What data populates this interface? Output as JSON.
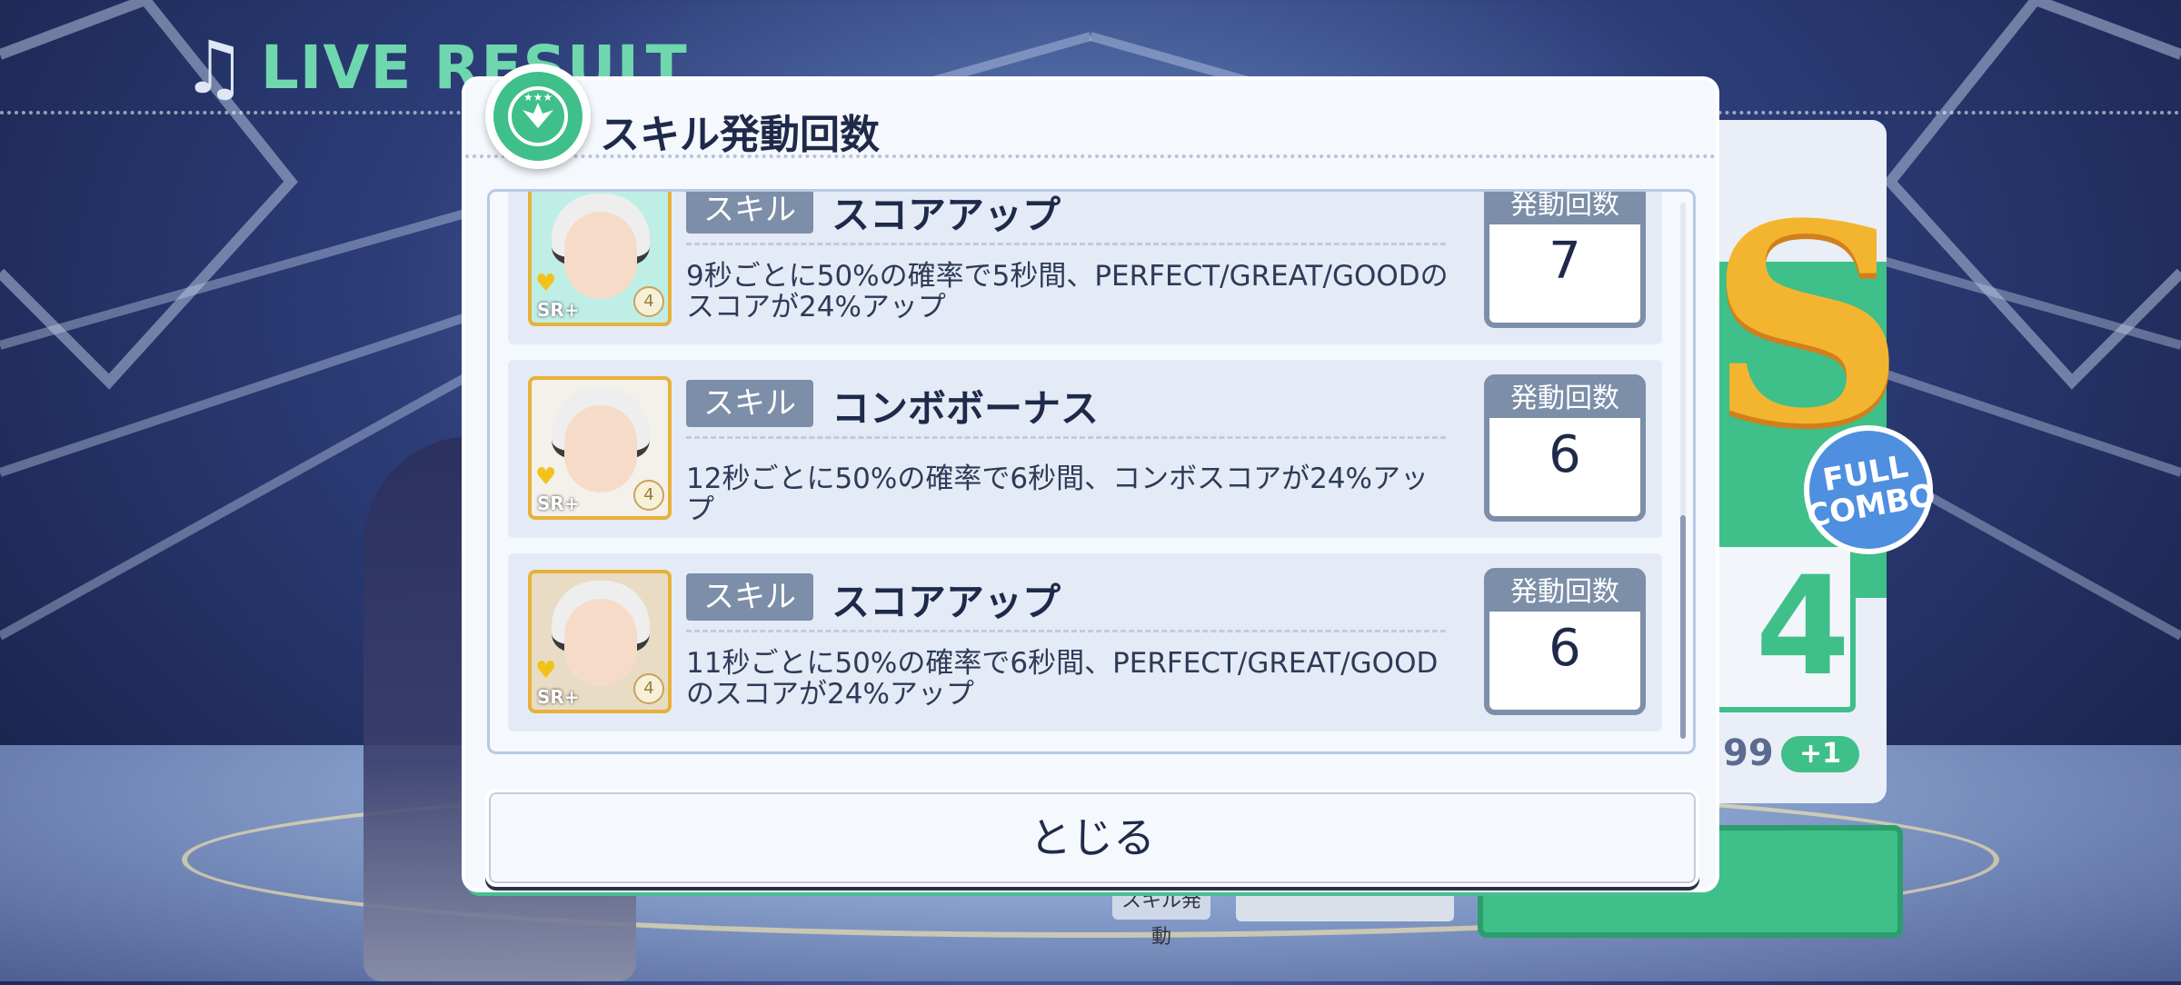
{
  "background": {
    "header_label": "LIVE RESULT",
    "rank": "S",
    "full_combo": "FULL COMBO",
    "combo_digit": "4",
    "score_tail": "99",
    "plus_badge": "+1",
    "skill_chip": "スキル発動"
  },
  "modal": {
    "title": "スキル発動回数",
    "close_label": "とじる",
    "rows": [
      {
        "tag": "スキル",
        "name": "スコアアップ",
        "description": "9秒ごとに50%の確率で5秒間、PERFECT/GREAT/GOODのスコアが24%アップ",
        "count_label": "発動回数",
        "count": "7",
        "rarity": "SR+",
        "level": "4"
      },
      {
        "tag": "スキル",
        "name": "コンボボーナス",
        "description": "12秒ごとに50%の確率で6秒間、コンボスコアが24%アップ",
        "count_label": "発動回数",
        "count": "6",
        "rarity": "SR+",
        "level": "4"
      },
      {
        "tag": "スキル",
        "name": "スコアアップ",
        "description": "11秒ごとに50%の確率で6秒間、PERFECT/GREAT/GOODのスコアが24%アップ",
        "count_label": "発動回数",
        "count": "6",
        "rarity": "SR+",
        "level": "4"
      }
    ]
  },
  "colors": {
    "accent_green": "#3fbf89",
    "tag_gray": "#7c8ea8",
    "text_dark": "#1f2a4a"
  }
}
